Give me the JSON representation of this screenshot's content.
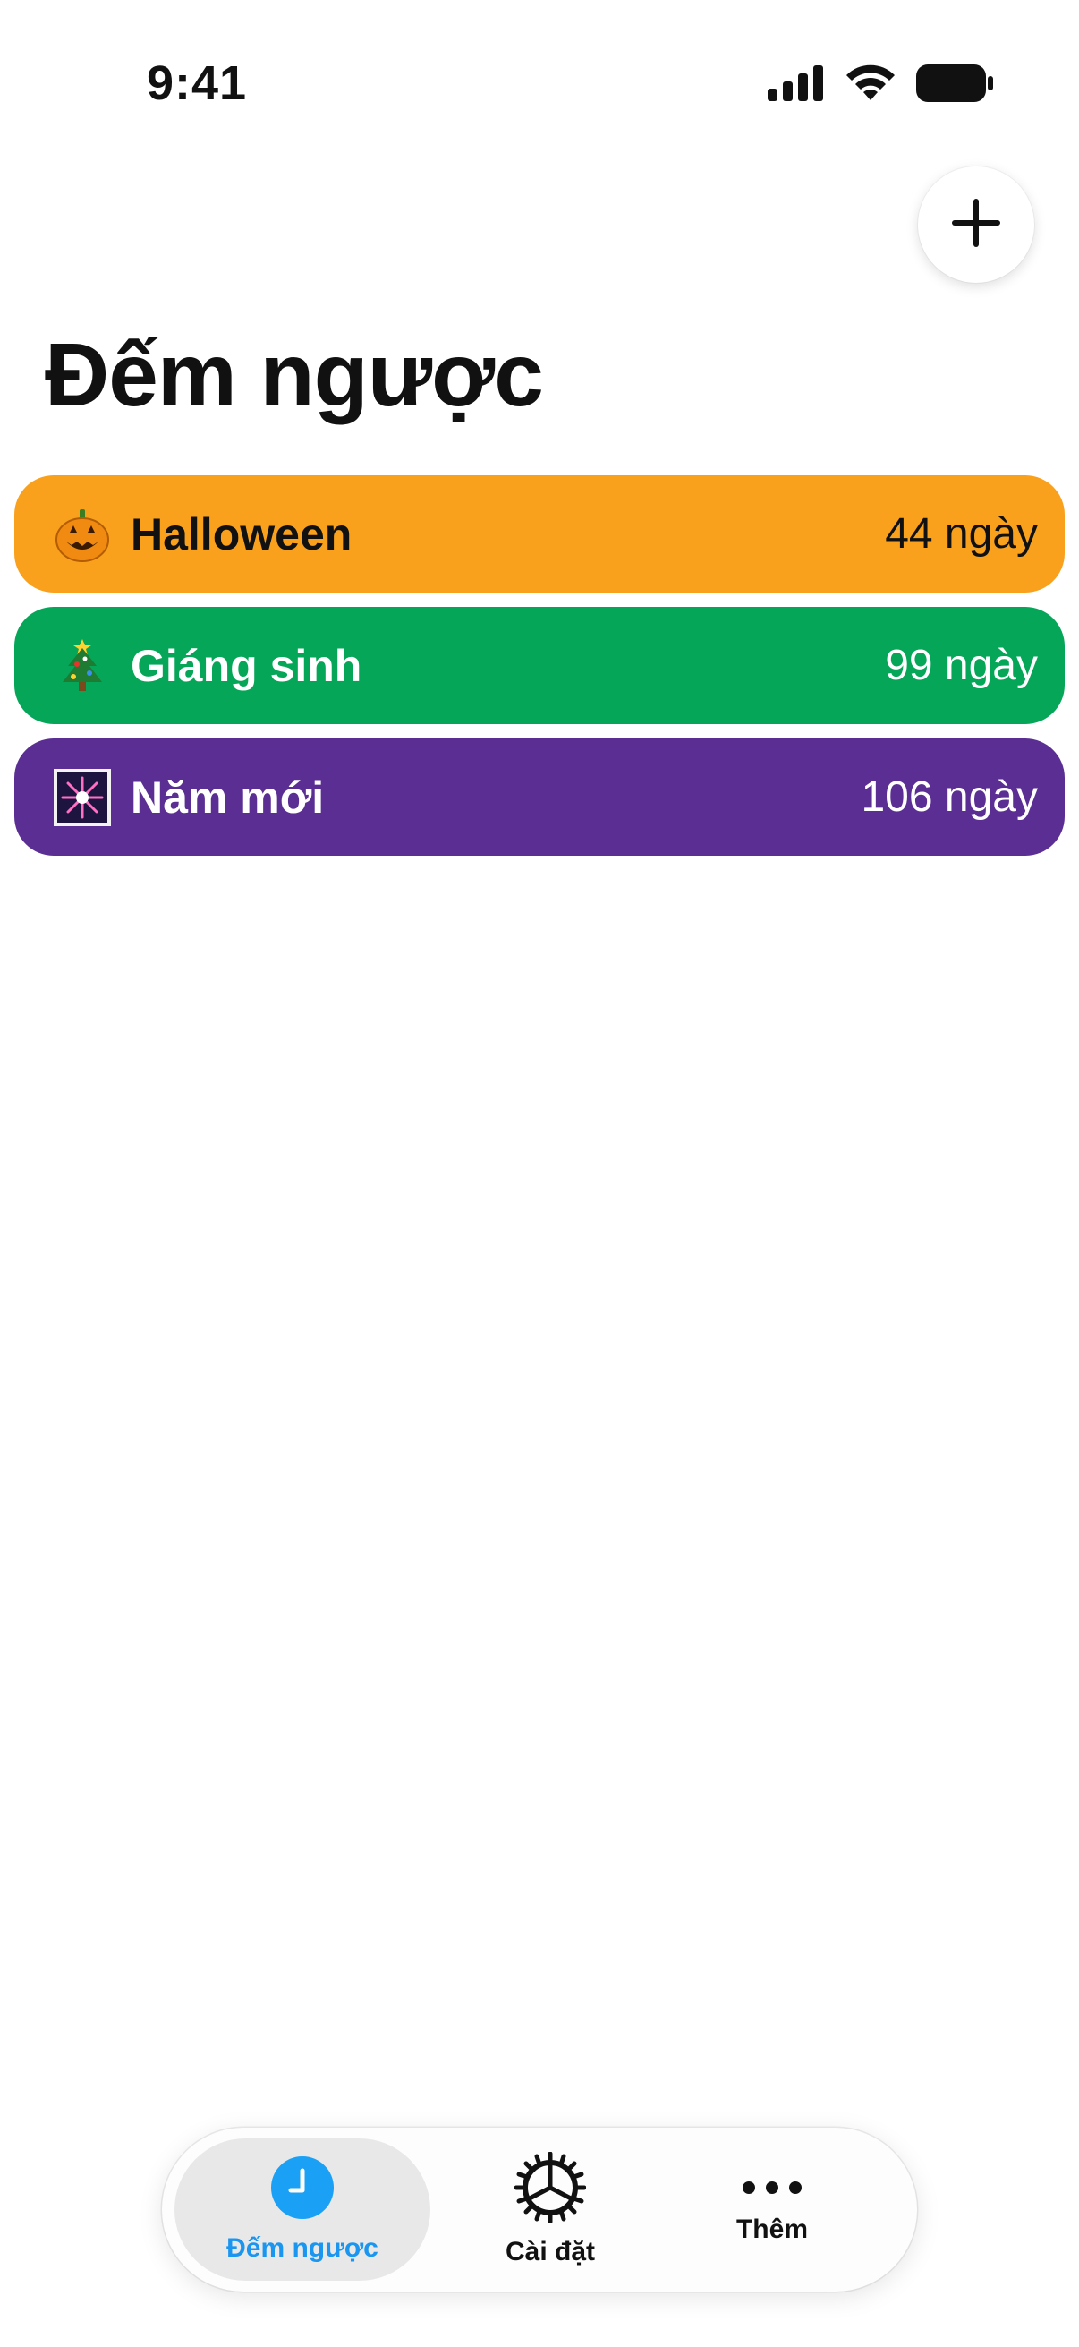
{
  "status_bar": {
    "time": "9:41",
    "icons": [
      "cellular-signal-icon",
      "wifi-icon",
      "battery-icon"
    ]
  },
  "header": {
    "add_button_icon": "plus-icon",
    "title": "Đếm ngược"
  },
  "countdowns": [
    {
      "emoji": "jack-o-lantern-icon",
      "name": "Halloween",
      "days": "44 ngày",
      "color": "#f9a11d",
      "text_color": "#111111"
    },
    {
      "emoji": "christmas-tree-icon",
      "name": "Giáng sinh",
      "days": "99 ngày",
      "color": "#06a659",
      "text_color": "#ffffff"
    },
    {
      "emoji": "fireworks-icon",
      "name": "Năm mới",
      "days": "106 ngày",
      "color": "#5b2e93",
      "text_color": "#ffffff"
    }
  ],
  "tab_bar": {
    "tabs": [
      {
        "label": "Đếm ngược",
        "icon": "clock-icon",
        "active": true
      },
      {
        "label": "Cài đặt",
        "icon": "gear-icon",
        "active": false
      },
      {
        "label": "Thêm",
        "icon": "more-icon",
        "active": false
      }
    ],
    "accent": "#1a96f0"
  }
}
